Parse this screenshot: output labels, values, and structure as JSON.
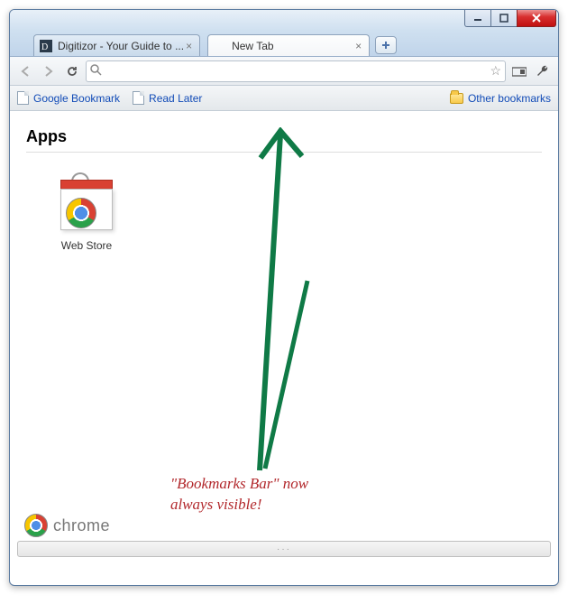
{
  "tabs": [
    {
      "title": "Digitizor - Your Guide to ...",
      "active": false
    },
    {
      "title": "New Tab",
      "active": true
    }
  ],
  "omnibox": {
    "value": "",
    "placeholder": ""
  },
  "bookmarks_bar": {
    "items": [
      {
        "label": "Google Bookmark"
      },
      {
        "label": "Read Later"
      }
    ],
    "other_label": "Other bookmarks"
  },
  "apps": {
    "heading": "Apps",
    "tiles": [
      {
        "label": "Web Store"
      }
    ]
  },
  "footer": {
    "brand": "chrome"
  },
  "annotation": {
    "text_line1": "\"Bookmarks Bar\" now",
    "text_line2": "always visible!"
  }
}
